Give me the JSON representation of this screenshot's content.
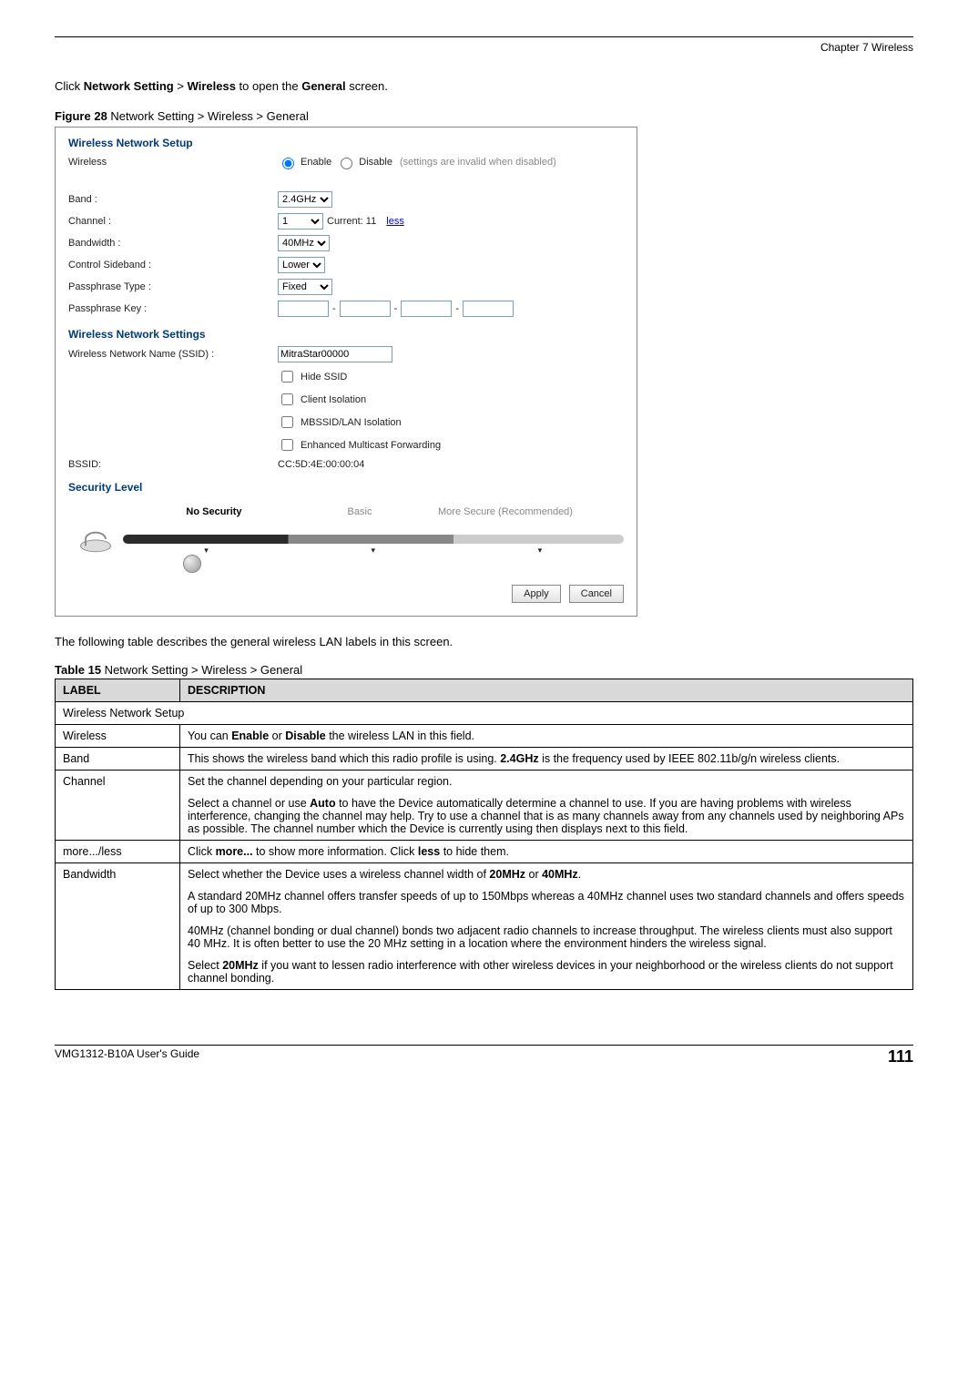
{
  "chapter": "Chapter 7 Wireless",
  "intro_html": "Click <b>Network Setting</b> > <b>Wireless</b> to open the <b>General</b> screen.",
  "figcap_html": "<b>Figure 28</b>   Network Setting > Wireless > General",
  "screenshot": {
    "section1_title": "Wireless Network Setup",
    "wireless_label": "Wireless",
    "enable_label": "Enable",
    "disable_label": "Disable",
    "disable_hint": "(settings are invalid when disabled)",
    "band_label": "Band :",
    "band_value": "2.4GHz",
    "channel_label": "Channel :",
    "channel_value": "1",
    "channel_current": "Current: 11",
    "channel_link": "less",
    "bandwidth_label": "Bandwidth :",
    "bandwidth_value": "40MHz",
    "sideband_label": "Control Sideband :",
    "sideband_value": "Lower",
    "pptype_label": "Passphrase Type :",
    "pptype_value": "Fixed",
    "ppkey_label": "Passphrase Key :",
    "section2_title": "Wireless Network Settings",
    "ssid_label": "Wireless Network Name (SSID) :",
    "ssid_value": "MitraStar00000",
    "hide_ssid": "Hide SSID",
    "client_iso": "Client Isolation",
    "mbssid_iso": "MBSSID/LAN Isolation",
    "emf": "Enhanced Multicast Forwarding",
    "bssid_label": "BSSID:",
    "bssid_value": "CC:5D:4E:00:00:04",
    "section3_title": "Security Level",
    "sec_no": "No Security",
    "sec_basic": "Basic",
    "sec_more": "More Secure (Recommended)",
    "apply": "Apply",
    "cancel": "Cancel"
  },
  "tbl_intro": "The following table describes the general wireless LAN labels in this screen.",
  "tblcap_html": "<b>Table 15</b>   Network Setting > Wireless > General",
  "th_label": "LABEL",
  "th_desc": "DESCRIPTION",
  "rows": [
    {
      "span": true,
      "label": "Wireless Network Setup"
    },
    {
      "label": "Wireless",
      "desc_html": "You can <b>Enable</b> or <b>Disable</b> the wireless LAN in this field."
    },
    {
      "label": "Band",
      "desc_html": "This shows the wireless band which this radio profile is using. <b>2.4GHz</b> is the frequency used by IEEE 802.11b/g/n wireless clients."
    },
    {
      "label": "Channel",
      "desc_html": "<p>Set the channel depending on your particular region.</p><p>Select a channel or use <b>Auto</b> to have the Device automatically determine a channel to use. If you are having problems with wireless interference, changing the channel may help. Try to use a channel that is as many channels away from any channels used by neighboring APs as possible. The channel number which the Device is currently using then displays next to this field.</p>"
    },
    {
      "label": "more.../less",
      "desc_html": "Click <b>more...</b> to show more information. Click <b>less</b> to hide them."
    },
    {
      "label": "Bandwidth",
      "desc_html": "<p>Select whether the Device uses a wireless channel width of <b>20MHz</b> or <b>40MHz</b>.</p><p>A standard 20MHz channel offers transfer speeds of up to 150Mbps whereas a 40MHz channel uses two standard channels and offers speeds of up to 300 Mbps.</p><p>40MHz (channel bonding or dual channel) bonds two adjacent radio channels to increase throughput. The wireless clients must also support 40 MHz. It is often better to use the 20 MHz setting in a location where the environment hinders the wireless signal.</p><p>Select <b>20MHz</b> if you want to lessen radio interference with other wireless devices in your neighborhood or the wireless clients do not support channel bonding.</p>"
    }
  ],
  "footer_left": "VMG1312-B10A User's Guide",
  "footer_page": "111"
}
